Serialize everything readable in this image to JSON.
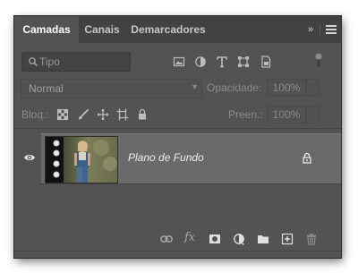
{
  "tabs": [
    {
      "label": "Camadas",
      "active": true
    },
    {
      "label": "Canais",
      "active": false
    },
    {
      "label": "Demarcadores",
      "active": false
    }
  ],
  "panel_controls": {
    "collapse_icon": "double-chevron-right-icon",
    "menu_icon": "hamburger-menu-icon"
  },
  "filter": {
    "kind_placeholder": "Tipo",
    "icons": [
      "pixel-layer-filter-icon",
      "adjustment-layer-filter-icon",
      "type-layer-filter-icon",
      "shape-layer-filter-icon",
      "smart-object-filter-icon"
    ]
  },
  "blend_mode": {
    "value": "Normal"
  },
  "opacity": {
    "label": "Opacidade:",
    "value": "100%"
  },
  "lock": {
    "label": "Bloq.:",
    "icons": [
      "lock-transparent-pixels-icon",
      "lock-image-pixels-icon",
      "lock-position-icon",
      "lock-artboard-icon",
      "lock-all-icon"
    ]
  },
  "fill": {
    "label": "Preen.:",
    "value": "100%"
  },
  "layers": [
    {
      "name": "Plano de Fundo",
      "visible": true,
      "locked": true,
      "selected": true
    }
  ],
  "bottom_toolbar": {
    "fx_label": "fx",
    "icons": [
      "link-layers-icon",
      "layer-style-icon",
      "add-mask-icon",
      "adjustment-layer-icon",
      "group-folder-icon",
      "new-layer-icon",
      "delete-layer-icon"
    ]
  },
  "colors": {
    "panel_bg": "#535353",
    "tab_bar_bg": "#424242",
    "selected_layer_bg": "#6a6a6a"
  }
}
